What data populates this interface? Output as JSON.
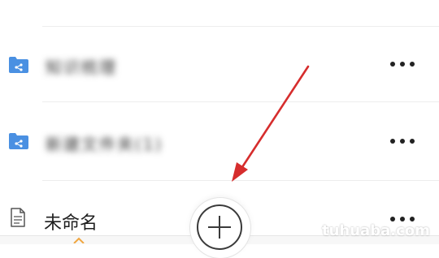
{
  "list": {
    "items": [
      {
        "type": "folder",
        "label": "知识梳理",
        "blurred": true
      },
      {
        "type": "folder",
        "label": "新建文件夹(1)",
        "blurred": true
      },
      {
        "type": "document",
        "label": "未命名",
        "blurred": false
      }
    ]
  },
  "watermark": "tuhuaba.com",
  "colors": {
    "folder": "#4a90e2",
    "arrow": "#d62d2d",
    "divider": "#ededed"
  }
}
